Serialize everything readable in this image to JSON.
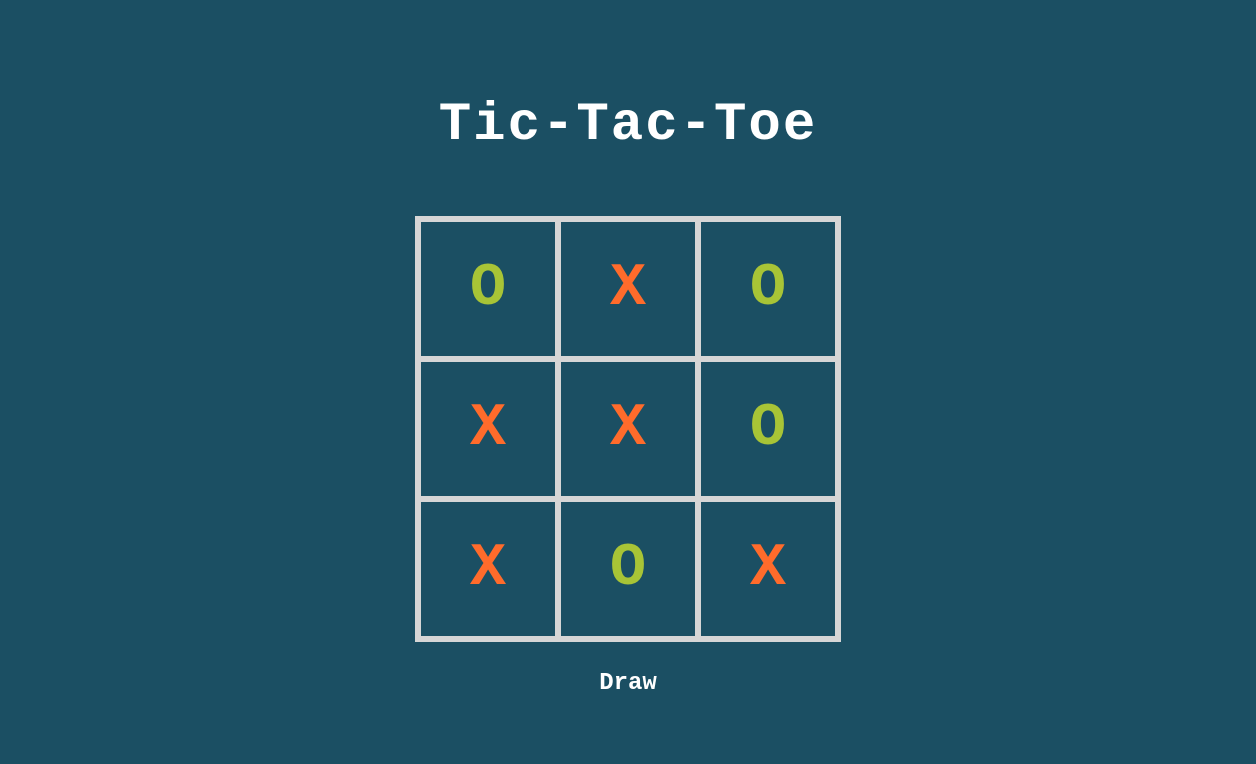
{
  "title": "Tic-Tac-Toe",
  "status": "Draw",
  "colors": {
    "background": "#1b4f63",
    "grid": "#d6d6d6",
    "x": "#ff6b2b",
    "o": "#a8c436",
    "text": "#ffffff"
  },
  "board": {
    "cells": [
      "O",
      "X",
      "O",
      "X",
      "X",
      "O",
      "X",
      "O",
      "X"
    ]
  }
}
